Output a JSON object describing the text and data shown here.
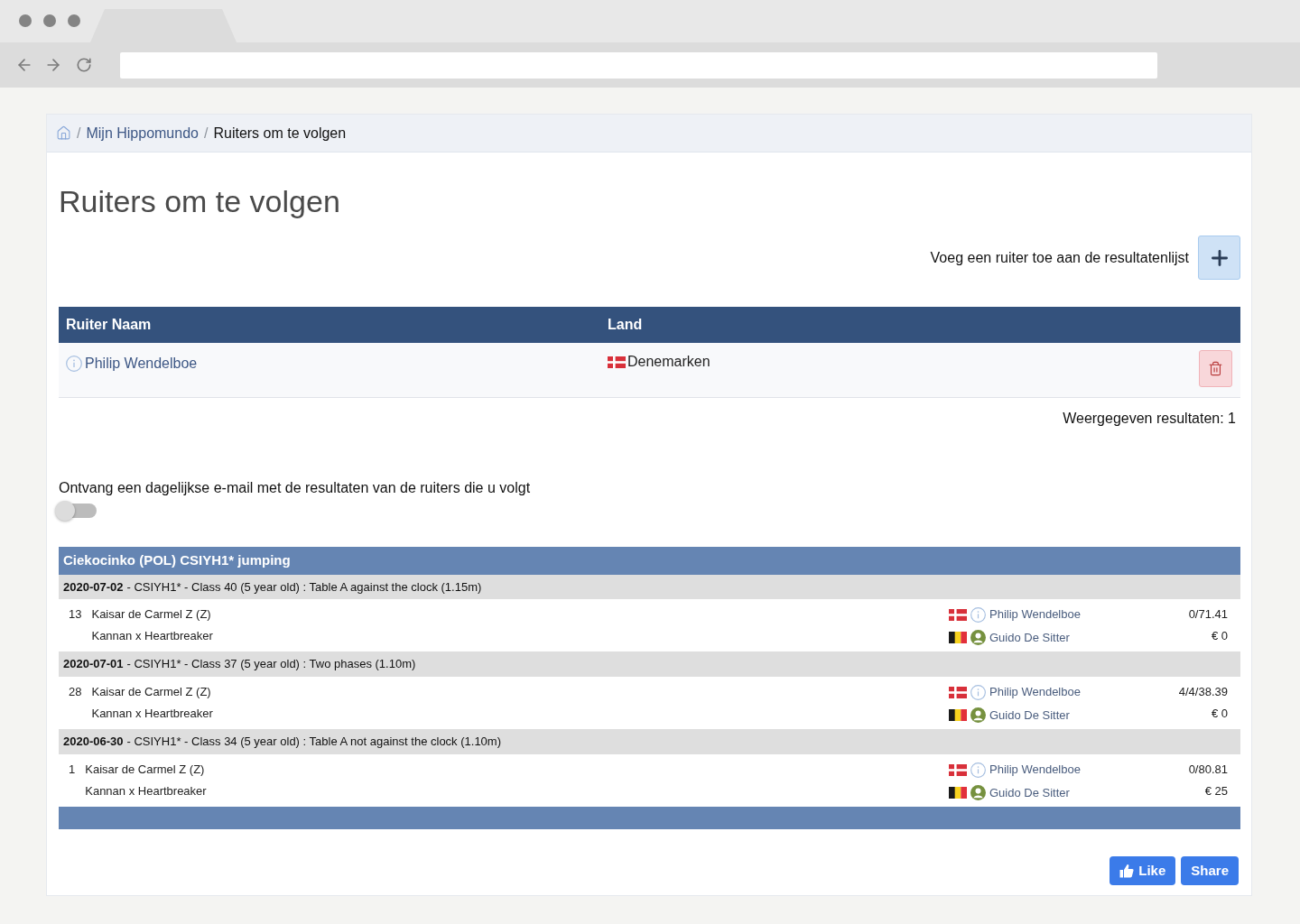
{
  "breadcrumb": [
    {
      "kind": "home",
      "separator": "/"
    },
    {
      "kind": "link",
      "label": "Mijn Hippomundo",
      "separator": "/"
    },
    {
      "kind": "page",
      "label": "Ruiters om te volgen"
    }
  ],
  "page_title": "Ruiters om te volgen",
  "add_rider": {
    "label": "Voeg een ruiter toe aan de resultatenlijst"
  },
  "riders_table": {
    "columns": [
      "Ruiter Naam",
      "Land"
    ],
    "rows": [
      {
        "name": "Philip Wendelboe",
        "country": "Denemarken"
      }
    ]
  },
  "results_count": "Weergegeven resultaten: 1",
  "email_toggle": {
    "label": "Ontvang een dagelijkse e-mail met de resultaten van de ruiters die u volgt",
    "on": false
  },
  "competitions": [
    {
      "title": "Ciekocinko (POL) CSIYH1* jumping",
      "classes": [
        {
          "date": "2020-07-02",
          "title": "- CSIYH1* - Class 40 (5 year old) : Table A against the clock (1.15m)",
          "entries": [
            {
              "rank": "13",
              "horse": "Kaisar de Carmel Z (Z)",
              "pedigree": "Kannan x Heartbreaker",
              "rider": "Philip Wendelboe",
              "owner": "Guido De Sitter",
              "result": "0/71.41",
              "prize": "€ 0"
            }
          ]
        },
        {
          "date": "2020-07-01",
          "title": "- CSIYH1* - Class 37 (5 year old) : Two phases (1.10m)",
          "entries": [
            {
              "rank": "28",
              "horse": "Kaisar de Carmel Z (Z)",
              "pedigree": "Kannan x Heartbreaker",
              "rider": "Philip Wendelboe",
              "owner": "Guido De Sitter",
              "result": "4/4/38.39",
              "prize": "€ 0"
            }
          ]
        },
        {
          "date": "2020-06-30",
          "title": "- CSIYH1* - Class 34 (5 year old) : Table A not against the clock (1.10m)",
          "entries": [
            {
              "rank": "1",
              "horse": "Kaisar de Carmel Z (Z)",
              "pedigree": "Kannan x Heartbreaker",
              "rider": "Philip Wendelboe",
              "owner": "Guido De Sitter",
              "result": "0/80.81",
              "prize": "€ 25"
            }
          ]
        }
      ]
    }
  ],
  "social_buttons": [
    {
      "kind": "like",
      "label": "Like"
    },
    {
      "kind": "share",
      "label": "Share"
    }
  ]
}
